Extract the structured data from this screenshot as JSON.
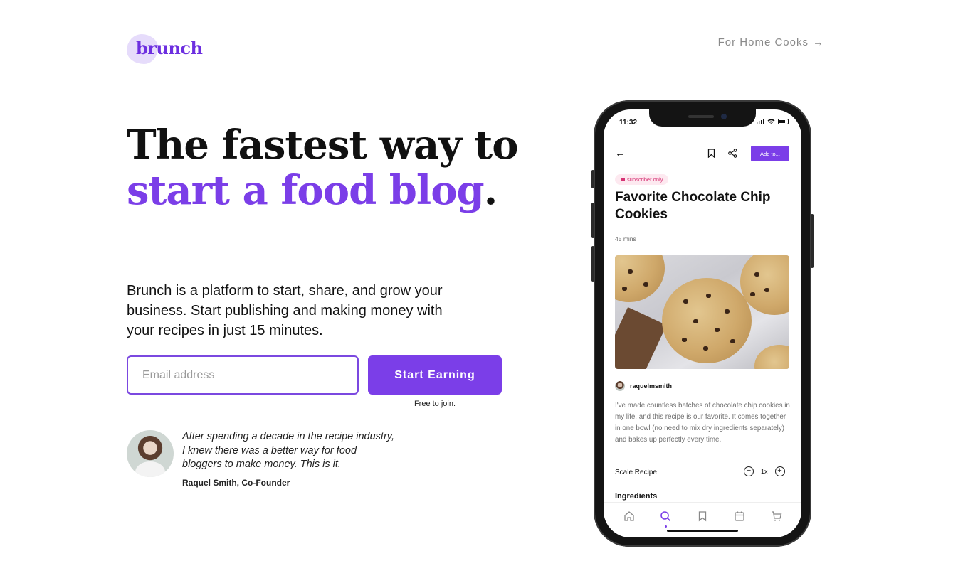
{
  "header": {
    "logo": "brunch",
    "nav_link": "For Home Cooks",
    "nav_arrow": "→"
  },
  "hero": {
    "headline_part1": "The fastest way to ",
    "headline_accent": "start a food blog",
    "headline_end": ".",
    "subcopy": "Brunch is a platform to start, share, and grow your business. Start publishing and making money with your recipes in just 15 minutes.",
    "email_placeholder": "Email address",
    "email_value": "",
    "cta_label": "Start Earning",
    "cta_note": "Free to join."
  },
  "testimonial": {
    "quote": "After spending a decade in the recipe industry, I knew there was a better way for food bloggers to make money. This is it.",
    "author": "Raquel Smith, Co-Founder"
  },
  "phone": {
    "time": "11:32",
    "add_button": "Add to...",
    "badge": "subscriber only",
    "recipe_title": "Favorite Chocolate Chip Cookies",
    "duration": "45 mins",
    "username": "raquelmsmith",
    "description": "I've made countless batches of chocolate chip cookies in my life, and this recipe is our favorite. It comes together in one bowl (no need to mix dry ingredients separately) and bakes up perfectly every time.",
    "scale_label": "Scale Recipe",
    "scale_value": "1x",
    "section_heading": "Ingredients",
    "tabs": [
      "home-icon",
      "search-icon",
      "bookmark-icon",
      "calendar-icon",
      "cart-icon"
    ],
    "active_tab": "search-icon"
  },
  "colors": {
    "accent": "#7b3ee8",
    "logo_blob": "#e6dcfb",
    "badge_bg": "#fde9f0",
    "badge_text": "#d63374"
  }
}
